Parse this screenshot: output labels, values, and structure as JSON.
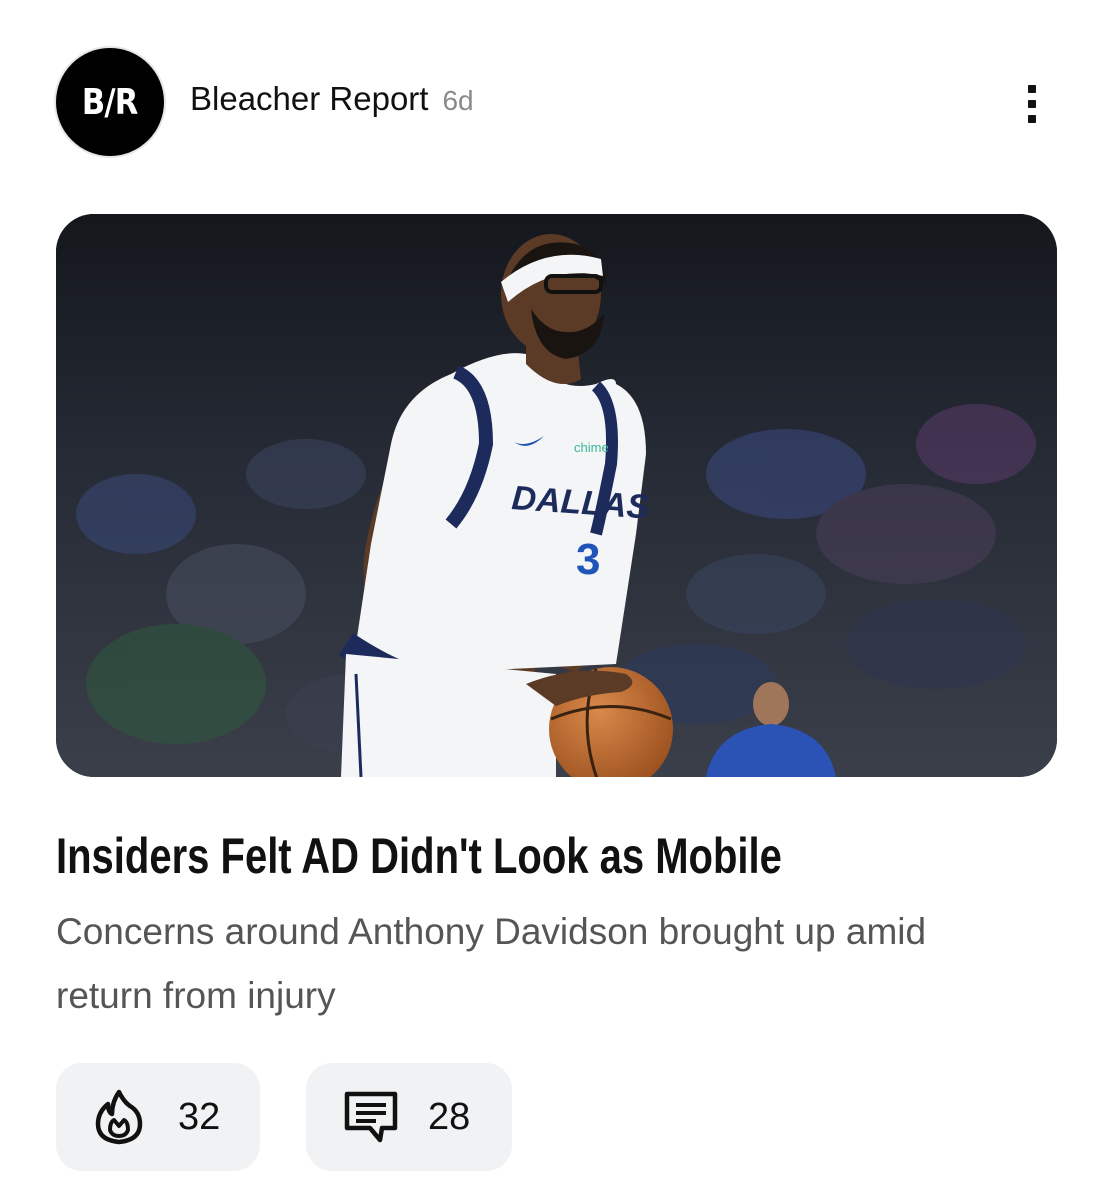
{
  "publisher": {
    "logo_text": "B/R",
    "name": "Bleacher Report",
    "age": "6d"
  },
  "menu": {
    "icon": "more-vertical-icon"
  },
  "hero_image": {
    "jersey_text": "DALLAS",
    "jersey_number": "3",
    "sponsor_text": "chime"
  },
  "article": {
    "headline": "Insiders Felt AD Didn't Look as Mobile",
    "summary": "Concerns around Anthony Davidson brought up amid return from injury"
  },
  "actions": {
    "reactions": {
      "icon": "fire-icon",
      "count": "32"
    },
    "comments": {
      "icon": "comment-icon",
      "count": "28"
    }
  },
  "colors": {
    "pill_background": "#f0f2f4",
    "headline": "#111111",
    "summary": "#555555",
    "timestamp": "#8a8a8a",
    "jersey_navy": "#1d2b5c",
    "jersey_blue": "#1f55b8"
  }
}
